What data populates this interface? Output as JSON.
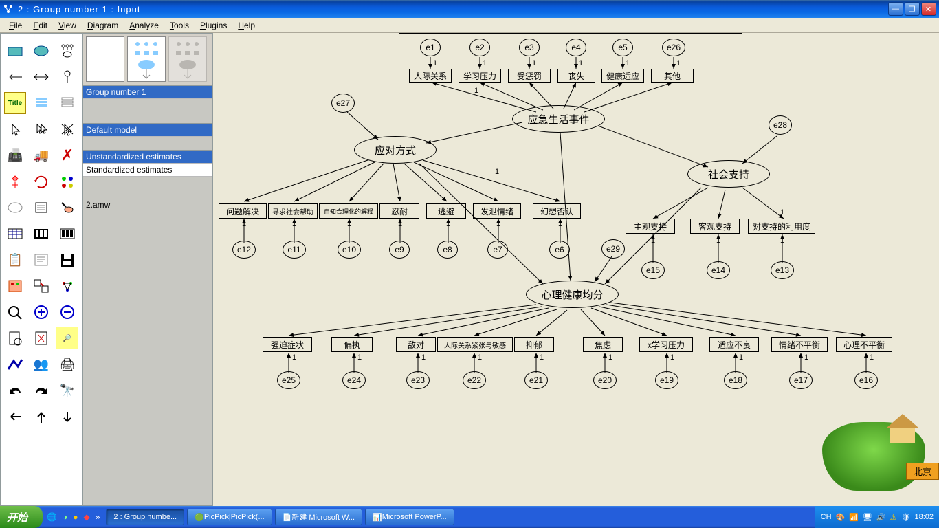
{
  "title": "2 : Group number 1 : Input",
  "menu": {
    "file": "File",
    "edit": "Edit",
    "view": "View",
    "diagram": "Diagram",
    "analyze": "Analyze",
    "tools": "Tools",
    "plugins": "Plugins",
    "help": "Help"
  },
  "panels": {
    "group": "Group number 1",
    "model": "Default model",
    "est1": "Unstandardized estimates",
    "est2": "Standardized estimates",
    "file": "2.amw"
  },
  "latent": {
    "l1": "应急生活事件",
    "l2": "应对方式",
    "l3": "社会支持",
    "l4": "心理健康均分"
  },
  "errors": {
    "e1": "e1",
    "e2": "e2",
    "e3": "e3",
    "e4": "e4",
    "e5": "e5",
    "e26": "e26",
    "e27": "e27",
    "e28": "e28",
    "e29": "e29",
    "e6": "e6",
    "e7": "e7",
    "e8": "e8",
    "e9": "e9",
    "e10": "e10",
    "e11": "e11",
    "e12": "e12",
    "e13": "e13",
    "e14": "e14",
    "e15": "e15",
    "e16": "e16",
    "e17": "e17",
    "e18": "e18",
    "e19": "e19",
    "e20": "e20",
    "e21": "e21",
    "e22": "e22",
    "e23": "e23",
    "e24": "e24",
    "e25": "e25"
  },
  "observed": {
    "v1": "人际关系",
    "v2": "学习压力",
    "v3": "受惩罚",
    "v4": "丧失",
    "v5": "健康适应",
    "v6": "其他",
    "c1": "问题解决",
    "c2": "寻求社会帮助",
    "c3": "自知合理化的解释",
    "c4": "忍耐",
    "c5": "逃避",
    "c6": "发泄情绪",
    "c7": "幻想否认",
    "s1": "主观支持",
    "s2": "客观支持",
    "s3": "对支持的利用度",
    "m1": "强迫症状",
    "m2": "偏执",
    "m3": "敌对",
    "m4": "人际关系紧张与敏感",
    "m5": "抑郁",
    "m6": "焦虑",
    "m7": "x学习压力",
    "m8": "适应不良",
    "m9": "情绪不平衡",
    "m10": "心理不平衡"
  },
  "lab_one": "1",
  "taskbar": {
    "start": "开始",
    "t1": "2 : Group numbe...",
    "t2": "PicPick|PicPick(...",
    "t3": "新建 Microsoft W...",
    "t4": "Microsoft PowerP...",
    "lang": "CH",
    "time": "18:02"
  },
  "widget": {
    "sign": "北京"
  }
}
